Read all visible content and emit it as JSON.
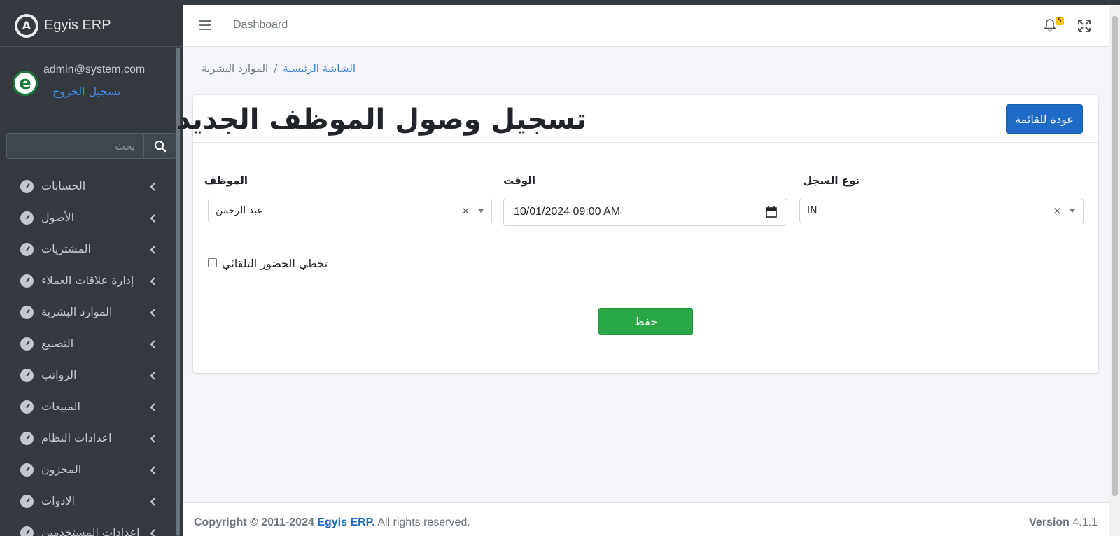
{
  "app": {
    "name": "Egyis ERP",
    "logo_letter": "A"
  },
  "user": {
    "email": "admin@system.com",
    "logout_label": "تسجيل الخروج",
    "avatar_letter": "e"
  },
  "sidebar": {
    "search_placeholder": "بحث",
    "items": [
      {
        "label": "الحسابات"
      },
      {
        "label": "الأصول"
      },
      {
        "label": "المشتريات"
      },
      {
        "label": "إدارة علاقات العملاء"
      },
      {
        "label": "الموارد البشرية"
      },
      {
        "label": "التصنيع"
      },
      {
        "label": "الرواتب"
      },
      {
        "label": "المبيعات"
      },
      {
        "label": "اعدادات النظام"
      },
      {
        "label": "المخزون"
      },
      {
        "label": "الادوات"
      },
      {
        "label": "اعدادات المستخدمين"
      }
    ]
  },
  "header": {
    "title": "Dashboard",
    "notifications_count": "5"
  },
  "breadcrumb": {
    "home": "الشاشة الرئيسية",
    "separator": "/",
    "current": "الموارد البشرية"
  },
  "card": {
    "title": "تسجيل وصول الموظف الجديد",
    "back_label": "عودة للقائمة"
  },
  "form": {
    "record_type": {
      "label": "نوع السجل",
      "value": "IN",
      "clear": "×"
    },
    "time": {
      "label": "الوقت",
      "value": "10/01/2024 09:00 AM"
    },
    "employee": {
      "label": "الموظف",
      "value": "عبد الرحمن",
      "clear": "×"
    },
    "skip_auto_attendance": {
      "label": "تخطي الحضور التلقائي",
      "checked": false
    },
    "save_label": "حفظ"
  },
  "footer": {
    "copyright_prefix": "Copyright © 2011-2024",
    "brand": "Egyis ERP.",
    "rights": "All rights reserved.",
    "version_label": "Version",
    "version": "4.1.1"
  },
  "colors": {
    "sidebar_bg": "#343a40",
    "primary": "#1e6bc6",
    "success": "#28a745",
    "badge": "#ffc107"
  }
}
